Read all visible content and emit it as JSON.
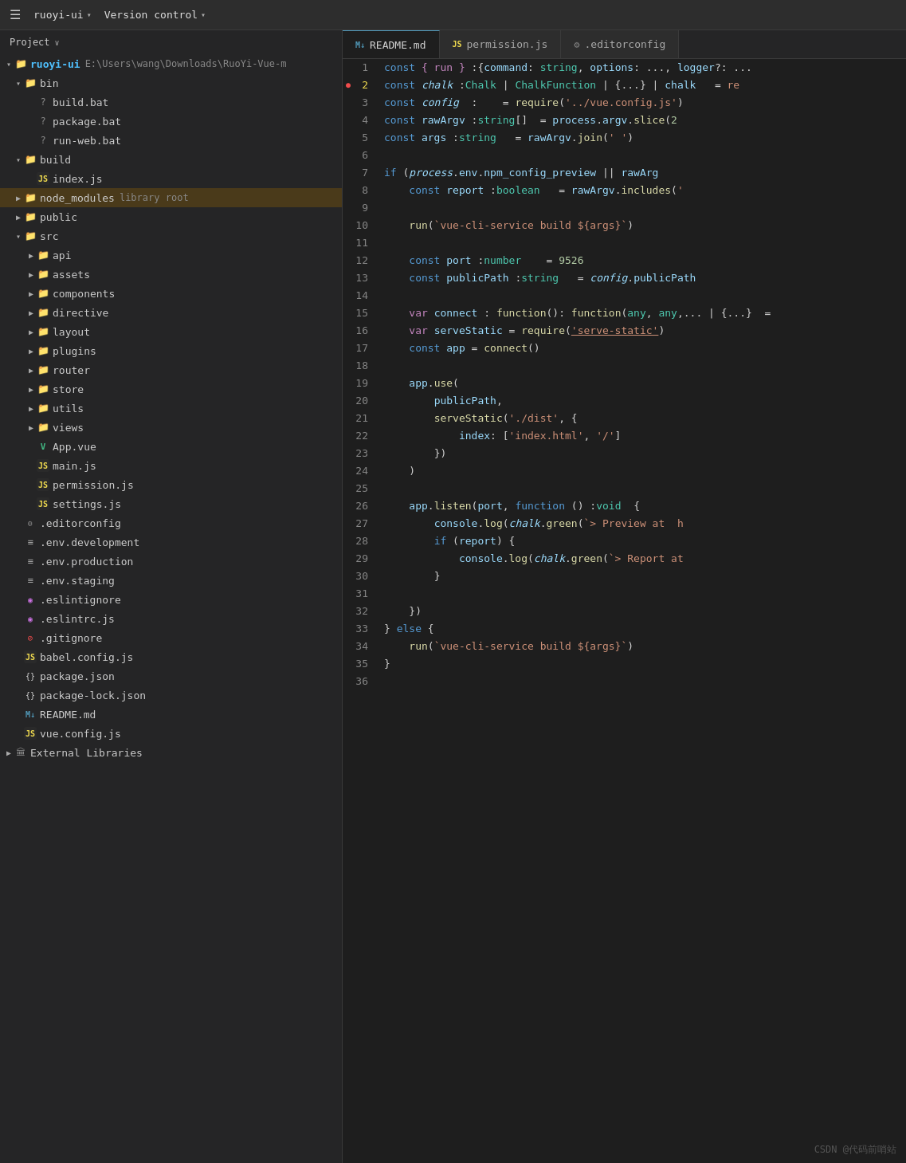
{
  "titlebar": {
    "menu_icon": "☰",
    "project_name": "ruoyi-ui",
    "project_chevron": "▾",
    "vcs_label": "Version control",
    "vcs_chevron": "▾"
  },
  "sidebar": {
    "header_label": "Project",
    "header_chevron": "∨",
    "items": [
      {
        "id": "ruoyi-ui-root",
        "label": "ruoyi-ui",
        "path": "E:\\Users\\wang\\Downloads\\RuoYi-Vue-m",
        "type": "root-folder",
        "level": 0,
        "expanded": true
      },
      {
        "id": "bin",
        "label": "bin",
        "type": "folder",
        "level": 1,
        "expanded": true
      },
      {
        "id": "build-bat",
        "label": "build.bat",
        "type": "bat",
        "level": 2
      },
      {
        "id": "package-bat",
        "label": "package.bat",
        "type": "bat",
        "level": 2
      },
      {
        "id": "run-web-bat",
        "label": "run-web.bat",
        "type": "bat",
        "level": 2
      },
      {
        "id": "build",
        "label": "build",
        "type": "folder",
        "level": 1,
        "expanded": true
      },
      {
        "id": "index-js",
        "label": "index.js",
        "type": "js",
        "level": 2
      },
      {
        "id": "node_modules",
        "label": "node_modules",
        "type": "folder",
        "level": 1,
        "expanded": false,
        "extra": "library root"
      },
      {
        "id": "public",
        "label": "public",
        "type": "folder",
        "level": 1,
        "expanded": false
      },
      {
        "id": "src",
        "label": "src",
        "type": "folder",
        "level": 1,
        "expanded": true
      },
      {
        "id": "api",
        "label": "api",
        "type": "folder",
        "level": 2,
        "expanded": false
      },
      {
        "id": "assets",
        "label": "assets",
        "type": "folder",
        "level": 2,
        "expanded": false
      },
      {
        "id": "components",
        "label": "components",
        "type": "folder",
        "level": 2,
        "expanded": false
      },
      {
        "id": "directive",
        "label": "directive",
        "type": "folder",
        "level": 2,
        "expanded": false
      },
      {
        "id": "layout",
        "label": "layout",
        "type": "folder",
        "level": 2,
        "expanded": false
      },
      {
        "id": "plugins",
        "label": "plugins",
        "type": "folder",
        "level": 2,
        "expanded": false
      },
      {
        "id": "router",
        "label": "router",
        "type": "folder",
        "level": 2,
        "expanded": false
      },
      {
        "id": "store",
        "label": "store",
        "type": "folder",
        "level": 2,
        "expanded": false
      },
      {
        "id": "utils",
        "label": "utils",
        "type": "folder",
        "level": 2,
        "expanded": false
      },
      {
        "id": "views",
        "label": "views",
        "type": "folder",
        "level": 2,
        "expanded": false
      },
      {
        "id": "app-vue",
        "label": "App.vue",
        "type": "vue",
        "level": 2
      },
      {
        "id": "main-js",
        "label": "main.js",
        "type": "js",
        "level": 2
      },
      {
        "id": "permission-js",
        "label": "permission.js",
        "type": "js",
        "level": 2
      },
      {
        "id": "settings-js",
        "label": "settings.js",
        "type": "js",
        "level": 2
      },
      {
        "id": "editorconfig",
        "label": ".editorconfig",
        "type": "gear",
        "level": 1
      },
      {
        "id": "env-development",
        "label": ".env.development",
        "type": "env",
        "level": 1
      },
      {
        "id": "env-production",
        "label": ".env.production",
        "type": "env",
        "level": 1
      },
      {
        "id": "env-staging",
        "label": ".env.staging",
        "type": "env",
        "level": 1
      },
      {
        "id": "eslintignore",
        "label": ".eslintignore",
        "type": "eslint-o",
        "level": 1
      },
      {
        "id": "eslintrc-js",
        "label": ".eslintrc.js",
        "type": "eslint-o",
        "level": 1
      },
      {
        "id": "gitignore",
        "label": ".gitignore",
        "type": "gitignore",
        "level": 1
      },
      {
        "id": "babel-config-js",
        "label": "babel.config.js",
        "type": "js",
        "level": 1
      },
      {
        "id": "package-json",
        "label": "package.json",
        "type": "json",
        "level": 1
      },
      {
        "id": "package-lock-json",
        "label": "package-lock.json",
        "type": "json",
        "level": 1
      },
      {
        "id": "readme-md",
        "label": "README.md",
        "type": "md",
        "level": 1
      },
      {
        "id": "vue-config-js",
        "label": "vue.config.js",
        "type": "js",
        "level": 1
      },
      {
        "id": "external-libraries",
        "label": "External Libraries",
        "type": "ext-lib",
        "level": 0
      }
    ]
  },
  "tabs": [
    {
      "id": "readme",
      "label": "README.md",
      "type": "md",
      "active": false
    },
    {
      "id": "permission",
      "label": "permission.js",
      "type": "js",
      "active": false
    },
    {
      "id": "editorconfig",
      "label": ".editorconfig",
      "type": "gear",
      "active": false
    }
  ],
  "code_lines": [
    {
      "num": "1",
      "content": "const_run"
    },
    {
      "num": "2",
      "content": "const_chalk",
      "breakpoint": true
    },
    {
      "num": "3",
      "content": "const_config"
    },
    {
      "num": "4",
      "content": "const_rawArgv"
    },
    {
      "num": "5",
      "content": "const_args"
    },
    {
      "num": "6",
      "content": ""
    },
    {
      "num": "7",
      "content": "if_process"
    },
    {
      "num": "8",
      "content": "const_report"
    },
    {
      "num": "9",
      "content": ""
    },
    {
      "num": "10",
      "content": "run_vue_cli_1"
    },
    {
      "num": "11",
      "content": ""
    },
    {
      "num": "12",
      "content": "const_port"
    },
    {
      "num": "13",
      "content": "const_publicPath"
    },
    {
      "num": "14",
      "content": ""
    },
    {
      "num": "15",
      "content": "var_connect"
    },
    {
      "num": "16",
      "content": "var_serveStatic"
    },
    {
      "num": "17",
      "content": "const_app"
    },
    {
      "num": "18",
      "content": ""
    },
    {
      "num": "19",
      "content": "app_use"
    },
    {
      "num": "20",
      "content": "publicPath_comma"
    },
    {
      "num": "21",
      "content": "serveStatic_call"
    },
    {
      "num": "22",
      "content": "index_array"
    },
    {
      "num": "23",
      "content": "close_brace"
    },
    {
      "num": "24",
      "content": "close_paren"
    },
    {
      "num": "25",
      "content": ""
    },
    {
      "num": "26",
      "content": "app_listen"
    },
    {
      "num": "27",
      "content": "console_log_green_1"
    },
    {
      "num": "28",
      "content": "if_report"
    },
    {
      "num": "29",
      "content": "console_log_green_2"
    },
    {
      "num": "30",
      "content": "close_brace_2"
    },
    {
      "num": "31",
      "content": ""
    },
    {
      "num": "32",
      "content": "close_paren_2"
    },
    {
      "num": "33",
      "content": "else_brace"
    },
    {
      "num": "34",
      "content": "run_vue_cli_2"
    },
    {
      "num": "35",
      "content": "close_brace_3"
    },
    {
      "num": "36",
      "content": ""
    }
  ],
  "watermark": "CSDN @代码前哨站"
}
